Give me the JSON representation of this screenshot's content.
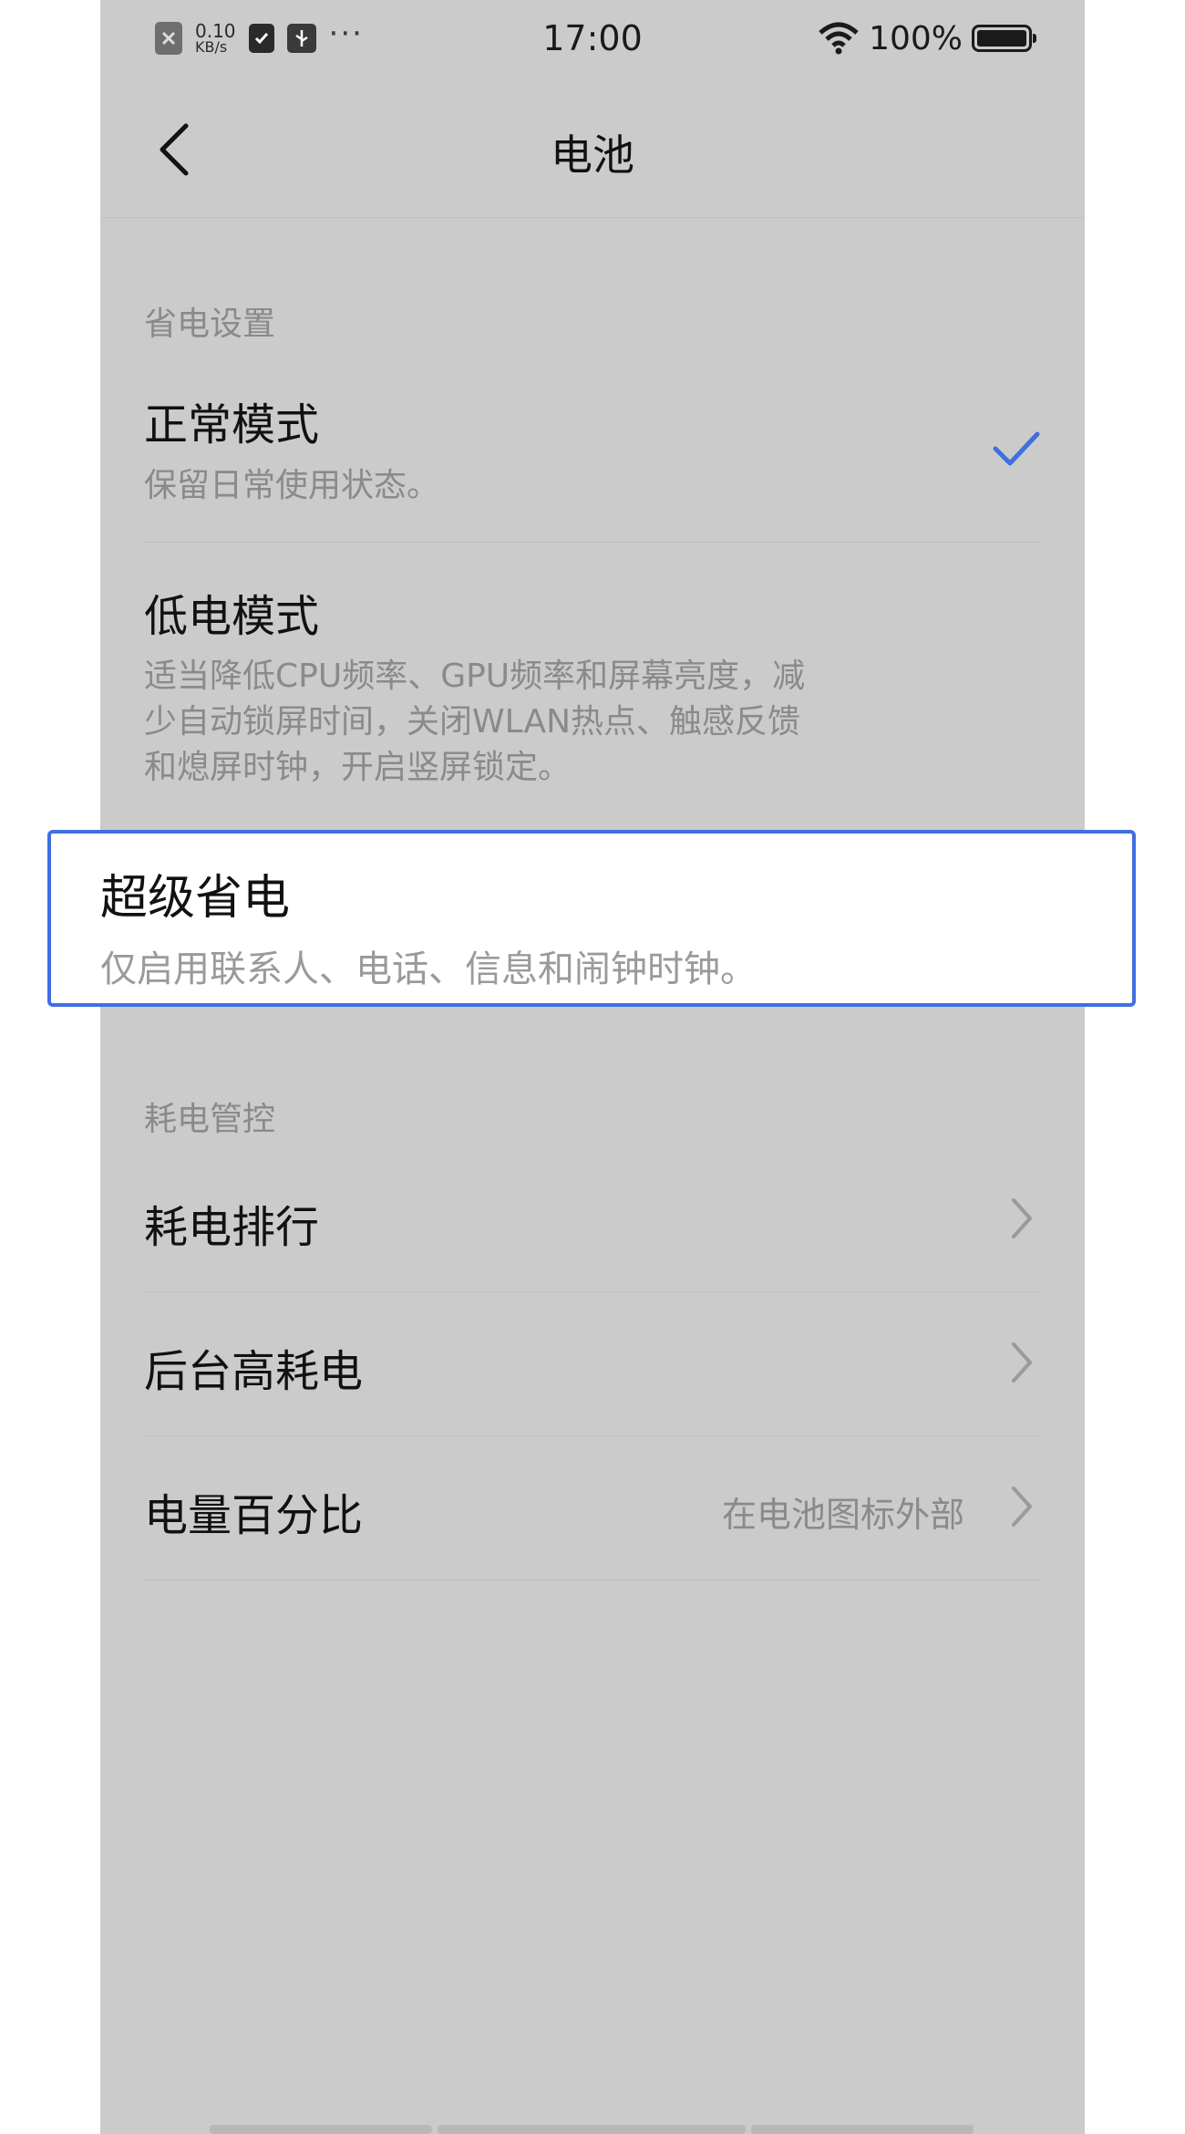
{
  "status_bar": {
    "net_speed_value": "0.10",
    "net_speed_unit": "KB/s",
    "more_dots": "···",
    "time": "17:00",
    "battery_pct": "100%"
  },
  "header": {
    "title": "电池"
  },
  "power_saving": {
    "section_title": "省电设置",
    "normal": {
      "title": "正常模式",
      "desc": "保留日常使用状态。",
      "selected": true
    },
    "low_power": {
      "title": "低电模式",
      "desc_lines": [
        "适当降低CPU频率、GPU频率和屏幕亮度，减",
        "少自动锁屏时间，关闭WLAN热点、触感反馈",
        "和熄屏时钟，开启竖屏锁定。"
      ]
    },
    "super_saver": {
      "title": "超级省电",
      "desc": "仅启用联系人、电话、信息和闹钟时钟。"
    }
  },
  "power_control": {
    "section_title": "耗电管控",
    "items": [
      {
        "label": "耗电排行"
      },
      {
        "label": "后台高耗电"
      },
      {
        "label": "电量百分比",
        "value": "在电池图标外部"
      }
    ]
  },
  "colors": {
    "accent": "#3f6fe0",
    "dim_background": "#cbcbcb"
  }
}
